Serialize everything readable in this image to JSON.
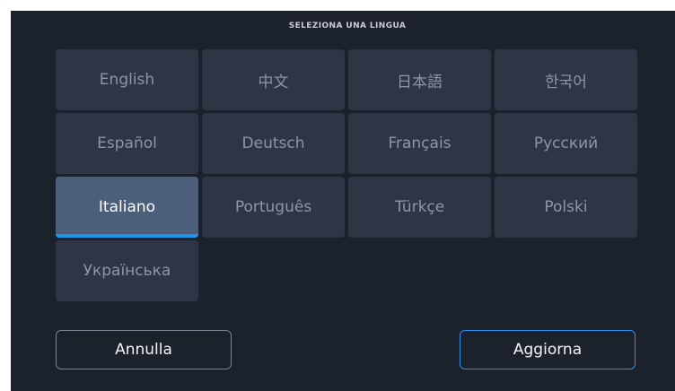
{
  "dialog": {
    "title": "SELEZIONA UNA LINGUA"
  },
  "languages": [
    {
      "label": "English",
      "selected": false
    },
    {
      "label": "中文",
      "selected": false
    },
    {
      "label": "日本語",
      "selected": false
    },
    {
      "label": "한국어",
      "selected": false
    },
    {
      "label": "Español",
      "selected": false
    },
    {
      "label": "Deutsch",
      "selected": false
    },
    {
      "label": "Français",
      "selected": false
    },
    {
      "label": "Русский",
      "selected": false
    },
    {
      "label": "Italiano",
      "selected": true
    },
    {
      "label": "Português",
      "selected": false
    },
    {
      "label": "Türkçe",
      "selected": false
    },
    {
      "label": "Polski",
      "selected": false
    },
    {
      "label": "Українська",
      "selected": false
    }
  ],
  "buttons": {
    "cancel_label": "Annulla",
    "update_label": "Aggiorna"
  },
  "colors": {
    "panel_bg": "#1c222c",
    "tile_bg": "#2e3645",
    "tile_selected_bg": "#4d5e7b",
    "accent": "#1e96ec"
  }
}
